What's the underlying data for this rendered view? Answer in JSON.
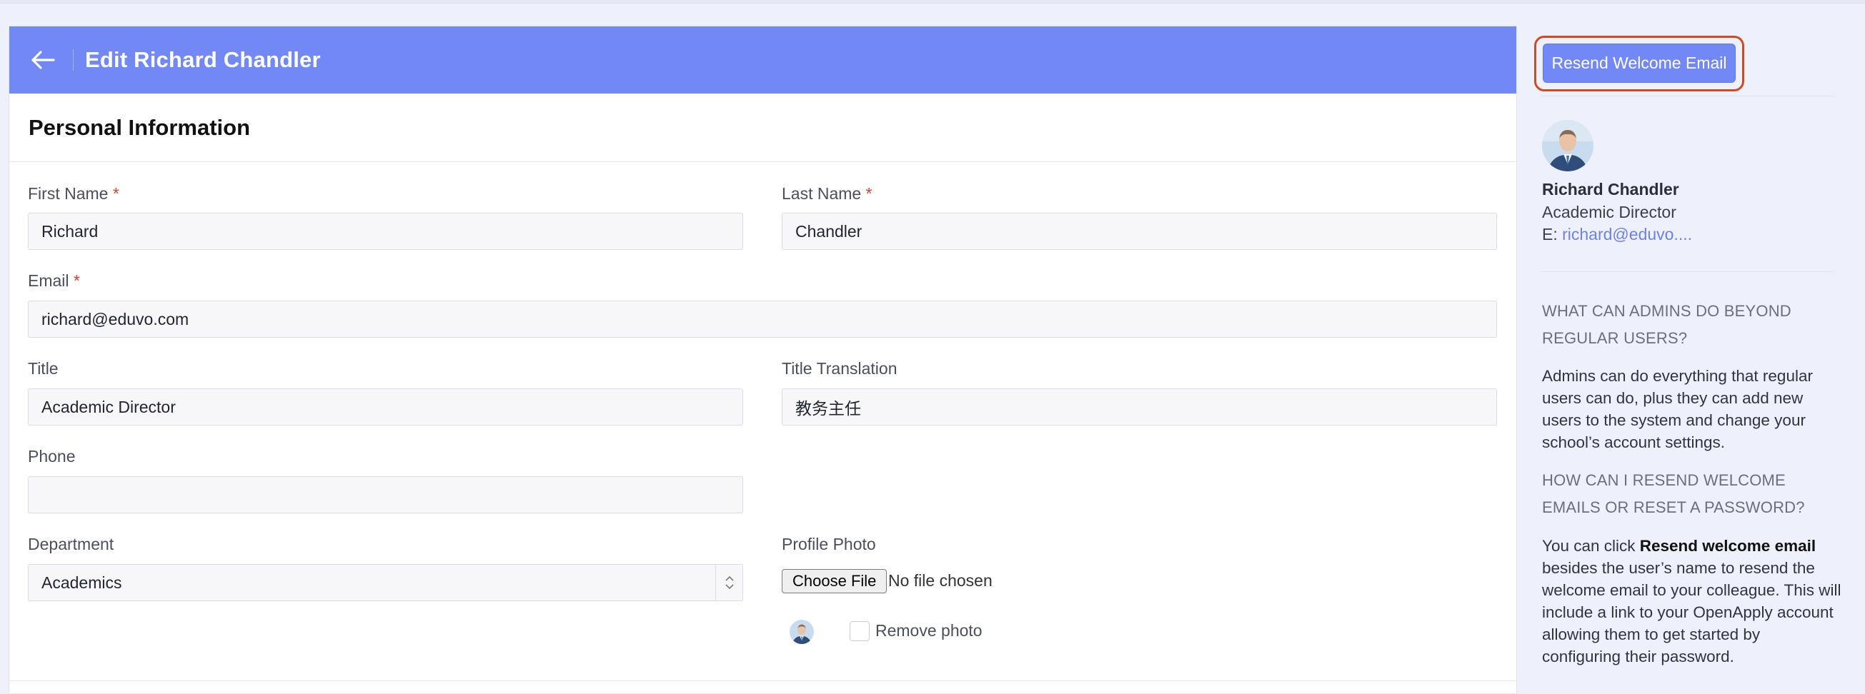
{
  "header": {
    "title": "Edit Richard Chandler",
    "back_icon": "arrow-left-icon"
  },
  "section": {
    "title": "Personal Information"
  },
  "form": {
    "first_name": {
      "label": "First Name",
      "required": "*",
      "value": "Richard"
    },
    "last_name": {
      "label": "Last Name",
      "required": "*",
      "value": "Chandler"
    },
    "email": {
      "label": "Email",
      "required": "*",
      "value": "richard@eduvo.com"
    },
    "title": {
      "label": "Title",
      "value": "Academic Director"
    },
    "title_translation": {
      "label": "Title Translation",
      "value": "教务主任"
    },
    "phone": {
      "label": "Phone",
      "value": ""
    },
    "department": {
      "label": "Department",
      "value": "Academics"
    },
    "profile_photo": {
      "label": "Profile Photo",
      "choose_label": "Choose File",
      "status": "No file chosen",
      "remove_label": "Remove photo"
    }
  },
  "sidebar": {
    "resend_label": "Resend Welcome Email",
    "user": {
      "name": "Richard Chandler",
      "role": "Academic Director",
      "email_prefix": "E:",
      "email_display": "richard@eduvo...."
    },
    "faq": [
      {
        "question": "What can admins do beyond regular users?",
        "answer": "Admins can do everything that regular users can do, plus they can add new users to the system and change your school’s account settings."
      },
      {
        "question": "How can I resend welcome emails or reset a password?",
        "answer_prefix": "You can click ",
        "answer_bold": "Resend welcome email",
        "answer_suffix": " besides the user’s name to resend the welcome email to your colleague. This will include a link to your OpenApply account allowing them to get started by configuring their password."
      }
    ]
  },
  "colors": {
    "header": "#7289f5",
    "accent": "#7289f5",
    "required": "#d0432e",
    "highlight": "#cf4a22",
    "link": "#6c82e8"
  }
}
